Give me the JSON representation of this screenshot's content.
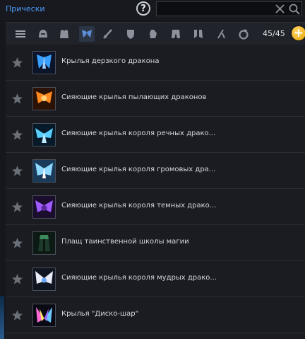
{
  "header": {
    "tab_title": "Прически",
    "help_label": "?",
    "search": {
      "value": "",
      "placeholder": ""
    }
  },
  "toolbar": {
    "icons": [
      "list-icon",
      "helmet-icon",
      "armor-icon",
      "wings-icon",
      "sword-icon",
      "shield-icon",
      "gauntlet-icon",
      "pants-icon",
      "boots-icon",
      "staff-icon",
      "ring-icon"
    ],
    "active_icon": "wings-icon",
    "count": "45/45",
    "add_label": "+"
  },
  "items": [
    {
      "label": "Крылья дерзкого дракона",
      "icon": "blue-dragon-wings-icon",
      "color": "#3aa0ff"
    },
    {
      "label": "Сияющие крылья пылающих драконов",
      "icon": "fire-dragon-wings-icon",
      "color": "#ff8a1f"
    },
    {
      "label": "Сияющие крылья короля речных драко...",
      "icon": "river-dragon-wings-icon",
      "color": "#5ad0ff"
    },
    {
      "label": "Сияющие крылья короля громовых дра...",
      "icon": "thunder-dragon-wings-icon",
      "color": "#8fd8ff"
    },
    {
      "label": "Сияющие крылья короля темных драко...",
      "icon": "dark-dragon-wings-icon",
      "color": "#a05cff"
    },
    {
      "label": "Плащ таинственной школы магии",
      "icon": "magic-cloak-icon",
      "color": "#3d8a5e"
    },
    {
      "label": "Сияющие крылья короля мудрых драко...",
      "icon": "wise-dragon-wings-icon",
      "color": "#e8eef8"
    },
    {
      "label": "Крылья \"Диско-шар\"",
      "icon": "disco-wings-icon",
      "color": "#ff6ad5"
    }
  ]
}
